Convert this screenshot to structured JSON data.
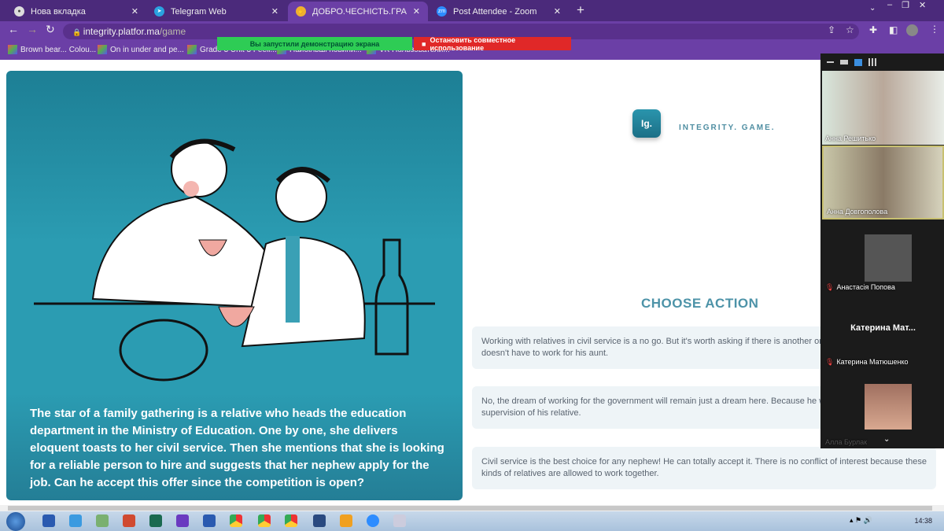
{
  "browser": {
    "tabs": [
      {
        "label": "Нова вкладка",
        "icon": "chrome-icon"
      },
      {
        "label": "Telegram Web",
        "icon": "telegram-icon"
      },
      {
        "label": "ДОБРО.ЧЕСНІСТЬ.ГРА",
        "icon": "hand-icon",
        "active": true
      },
      {
        "label": "Post Attendee - Zoom",
        "icon": "zoom-icon"
      }
    ],
    "url_host": "integrity.platfor.ma",
    "url_path": "/game",
    "bookmarks": [
      "Brown bear... Colou...",
      "On in under and pe...",
      "Grade 3 Unit 3 Feeli...",
      "Найбільші новини...",
      "VK Пользователи..."
    ],
    "share_banner": "Вы запустили демонстрацию экрана",
    "stop_share": "Остановить совместное использование"
  },
  "game": {
    "logo": "Ig.",
    "brand": "INTEGRITY. GAME.",
    "story": "The star of a family gathering is a relative who heads the education department in the Ministry of Education. One by one, she delivers eloquent toasts to her civil service. Then she mentions that she is looking for a reliable person to hire and suggests that her nephew apply for the job. Can he accept this offer since the competition is open?",
    "choose": "CHOOSE ACTION",
    "options": [
      "Working with relatives in civil service is a no go. But it's worth asking if there is another organization where he doesn't have to work for his aunt.",
      "No, the dream of working for the government will remain just a dream here. Because he would work under the supervision of his relative.",
      "Civil service is the best choice for any nephew! He can totally accept it. There is no conflict of interest because these kinds of relatives are allowed to work together."
    ]
  },
  "zoom": {
    "participants": [
      "Анна Решитько",
      "Анна Довгополова",
      "Анастасія Попова",
      "Катерина Матюшенко",
      "Алла Бурлак"
    ],
    "big_name": "Катерина  Мат..."
  },
  "taskbar": {
    "time": "14:38"
  }
}
